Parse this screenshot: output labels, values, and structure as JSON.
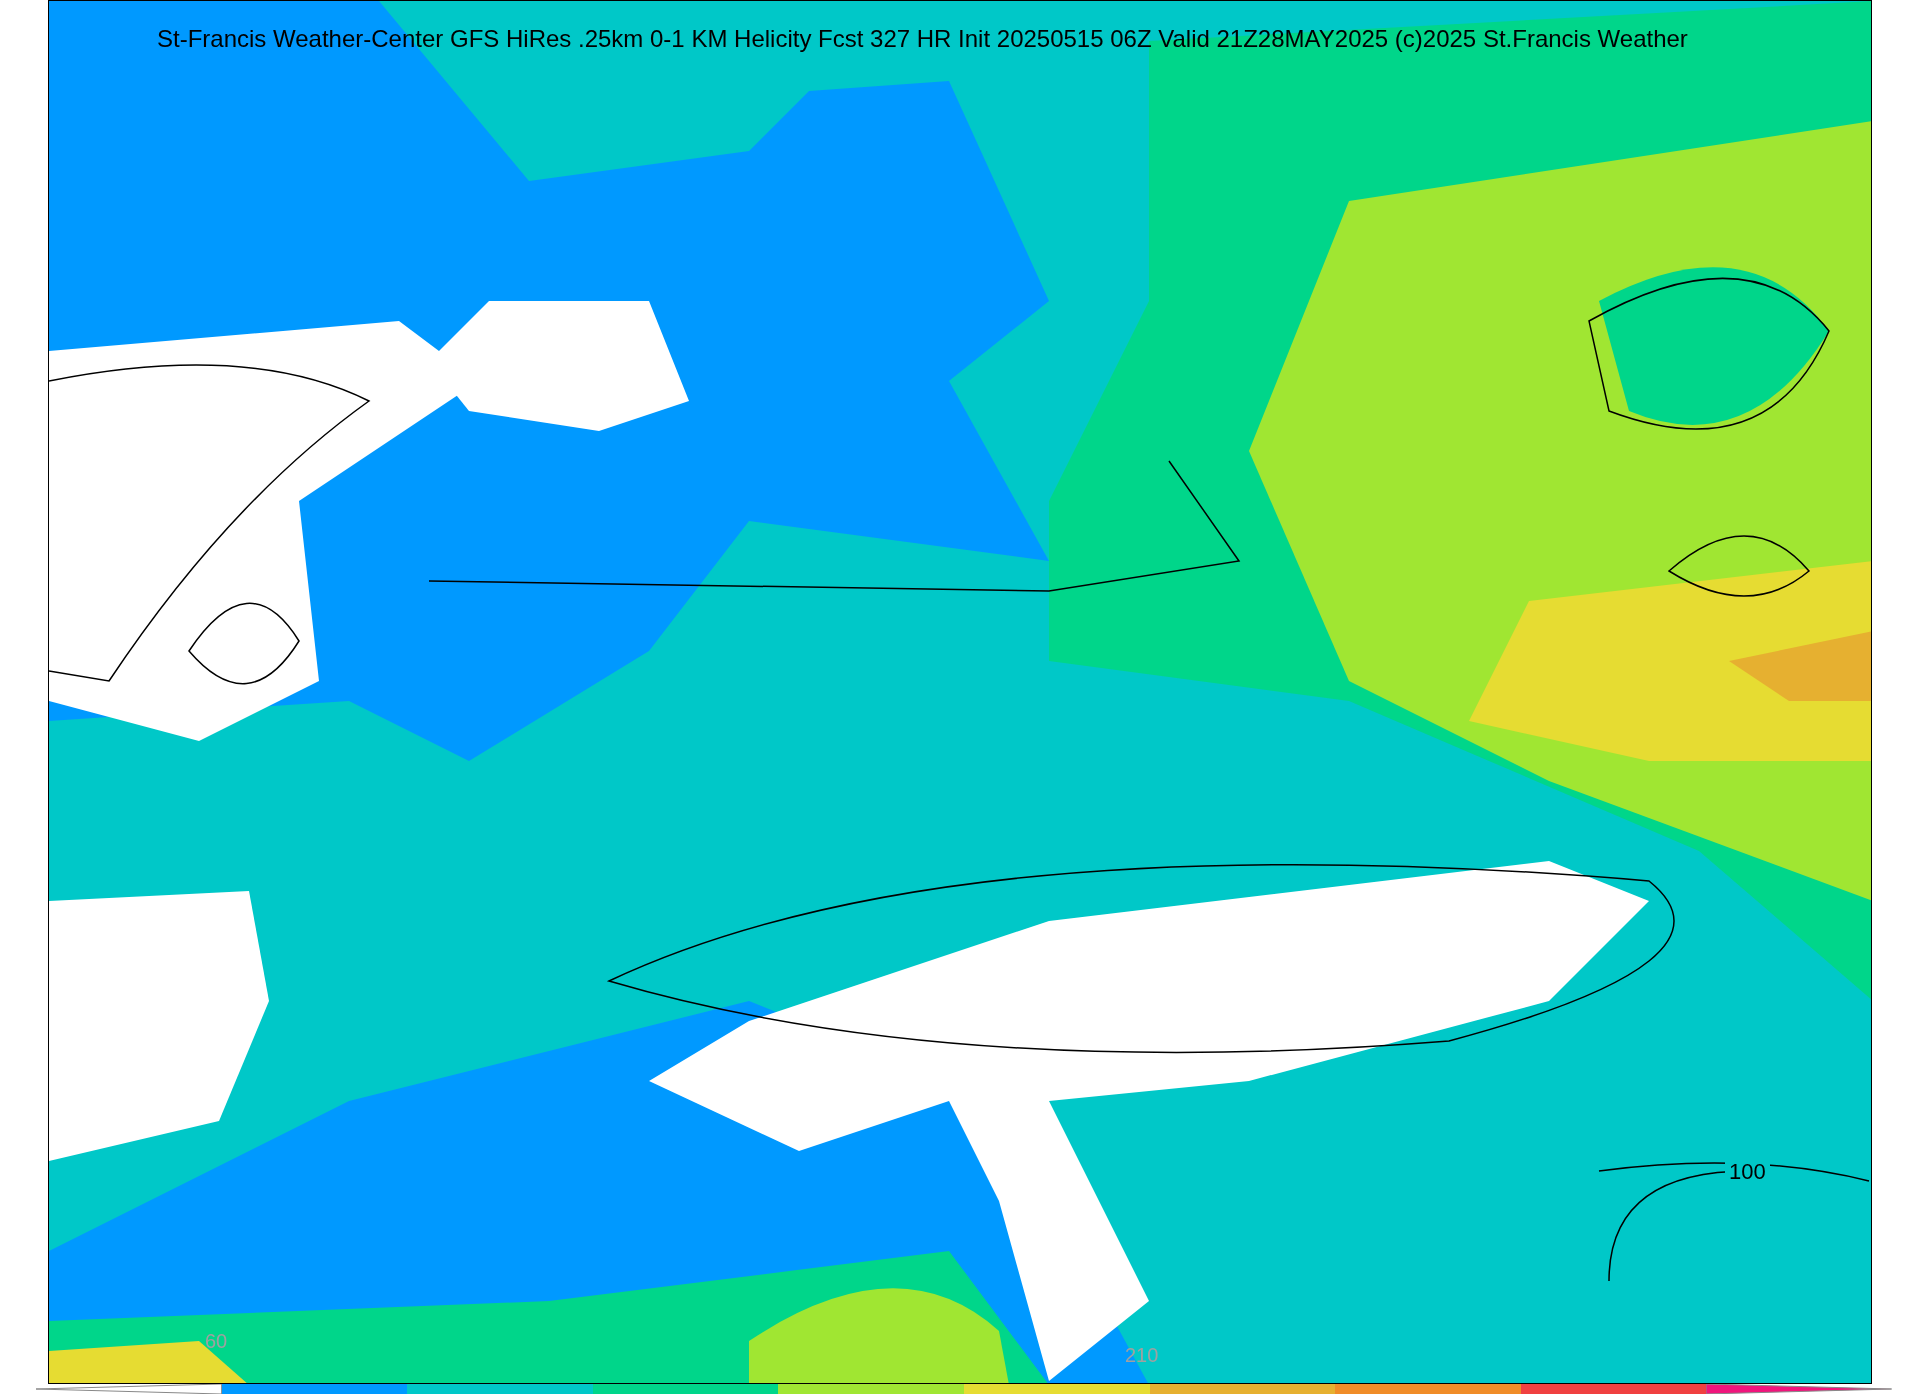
{
  "map": {
    "title": "St-Francis Weather-Center GFS HiRes .25km 0-1 KM Helicity Fcst 327 HR Init 20250515 06Z  Valid 21Z28MAY2025    (c)2025 St.Francis Weather",
    "contour_label": "100"
  },
  "colorbar": {
    "labels": [
      {
        "text": "60"
      },
      {
        "text": "210"
      }
    ],
    "segments": [
      {
        "color": "#ffffff"
      },
      {
        "color": "#0099ff"
      },
      {
        "color": "#00c8c8"
      },
      {
        "color": "#00d68a"
      },
      {
        "color": "#a0e632"
      },
      {
        "color": "#e6dc32"
      },
      {
        "color": "#e6b030"
      },
      {
        "color": "#f08c28"
      },
      {
        "color": "#f04040"
      },
      {
        "color": "#f0147c"
      }
    ]
  }
}
